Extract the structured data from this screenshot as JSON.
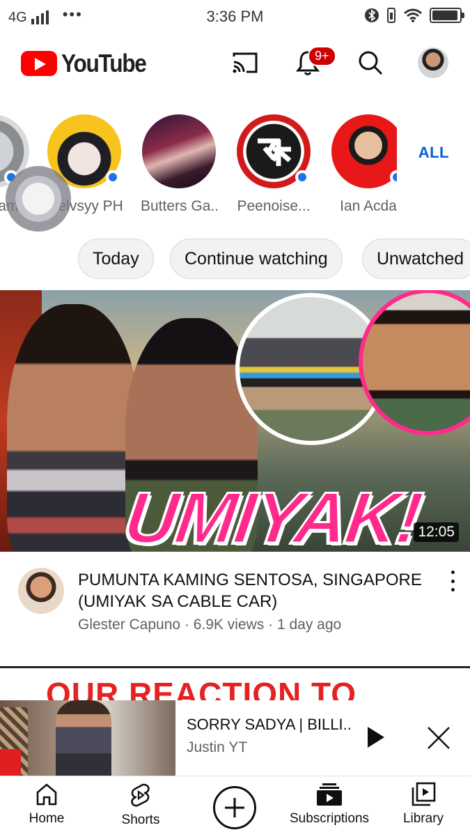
{
  "status_bar": {
    "network": "4G",
    "dots": "•••",
    "time": "3:36 PM"
  },
  "header": {
    "logo_text": "YouTube",
    "notification_count": "9+"
  },
  "channels": {
    "items": [
      {
        "name": "am..."
      },
      {
        "name": "Melvsyy PH"
      },
      {
        "name": "Butters Ga..."
      },
      {
        "name": "Peenoise..."
      },
      {
        "name": "Ian Acda"
      }
    ],
    "all_label": "ALL"
  },
  "chips": [
    "Today",
    "Continue watching",
    "Unwatched"
  ],
  "video": {
    "thumbnail_text": "UMIYAK!",
    "duration": "12:05",
    "title": "PUMUNTA KAMING SENTOSA, SINGAPORE (UMIYAK SA CABLE CAR)",
    "meta": "Glester Capuno · 6.9K views · 1 day ago"
  },
  "next_video": {
    "thumbnail_text": "OUR REACTION TO"
  },
  "mini_player": {
    "title": "SORRY SADYA | BILLI..",
    "channel": "Justin YT"
  },
  "bottom_nav": {
    "home": "Home",
    "shorts": "Shorts",
    "subscriptions": "Subscriptions",
    "library": "Library"
  },
  "colors": {
    "brand_red": "#ff0000",
    "accent_blue": "#065fd4",
    "thumbnail_pink": "#ff2a8c"
  }
}
